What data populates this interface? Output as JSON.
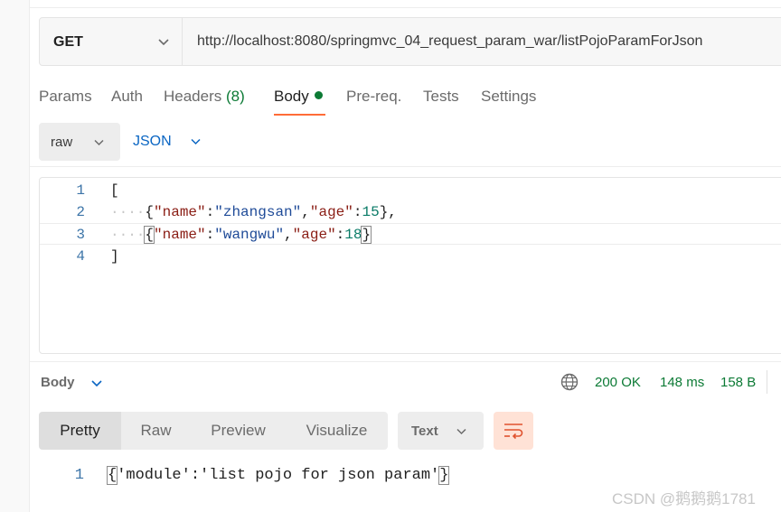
{
  "request": {
    "method": "GET",
    "url": "http://localhost:8080/springmvc_04_request_param_war/listPojoParamForJson"
  },
  "tabs": [
    {
      "label": "Params"
    },
    {
      "label": "Auth"
    },
    {
      "label": "Headers",
      "count": "(8)"
    },
    {
      "label": "Body"
    },
    {
      "label": "Pre-req."
    },
    {
      "label": "Tests"
    },
    {
      "label": "Settings"
    }
  ],
  "active_tab": "Body",
  "body_mode": {
    "type": "raw",
    "format": "JSON"
  },
  "editor": {
    "line_numbers": [
      "1",
      "2",
      "3",
      "4"
    ],
    "line1": "[",
    "line2": {
      "indent": "····",
      "open": "{",
      "k1": "\"name\"",
      "c1": ":",
      "v1": "\"zhangsan\"",
      "sep": ",",
      "k2": "\"age\"",
      "c2": ":",
      "v2": "15",
      "close": "},"
    },
    "line3": {
      "indent": "····",
      "open": "{",
      "k1": "\"name\"",
      "c1": ":",
      "v1": "\"wangwu\"",
      "sep": ",",
      "k2": "\"age\"",
      "c2": ":",
      "v2": "18",
      "close": "}"
    },
    "line4": "]"
  },
  "response": {
    "label": "Body",
    "status": "200 OK",
    "time": "148 ms",
    "size": "158 B",
    "views": [
      "Pretty",
      "Raw",
      "Preview",
      "Visualize"
    ],
    "active_view": "Pretty",
    "text_format": "Text",
    "line_number": "1",
    "body_open": "{",
    "body_text": "'module':'list pojo for json param'",
    "body_close": "}"
  },
  "watermark": "CSDN @鹅鹅鹅1781",
  "colors": {
    "accent": "#ff6c37",
    "success": "#0c7a35",
    "link": "#0b66c3"
  }
}
